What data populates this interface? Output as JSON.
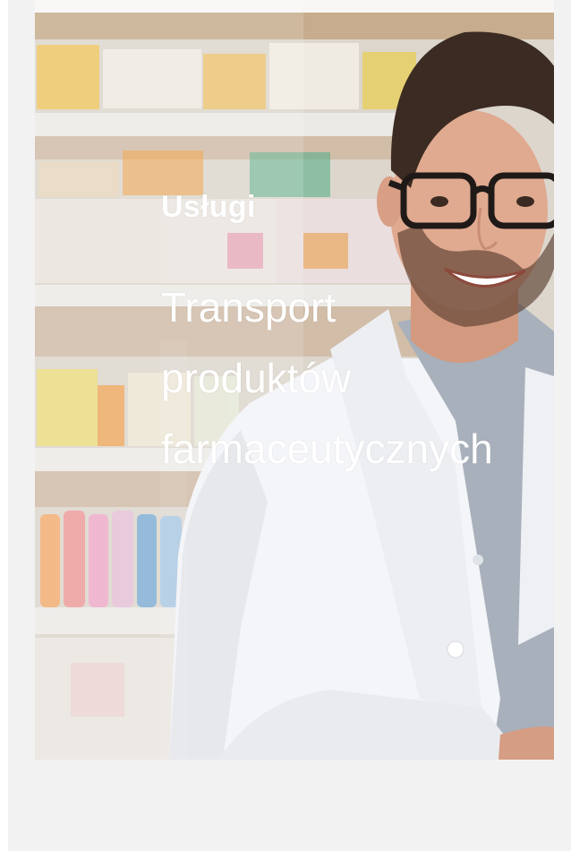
{
  "card": {
    "eyebrow": "Usługi",
    "title_lines": [
      "Transport",
      "produktów",
      "farmaceutycznych"
    ],
    "image_alt": "pharmacist-in-white-coat-with-glasses"
  },
  "colors": {
    "page_background": "#f2f2f2",
    "text": "#ffffff",
    "coat": "#f4f5f7",
    "shirt": "#a9b0ba",
    "shelf": "#e5e0da"
  }
}
